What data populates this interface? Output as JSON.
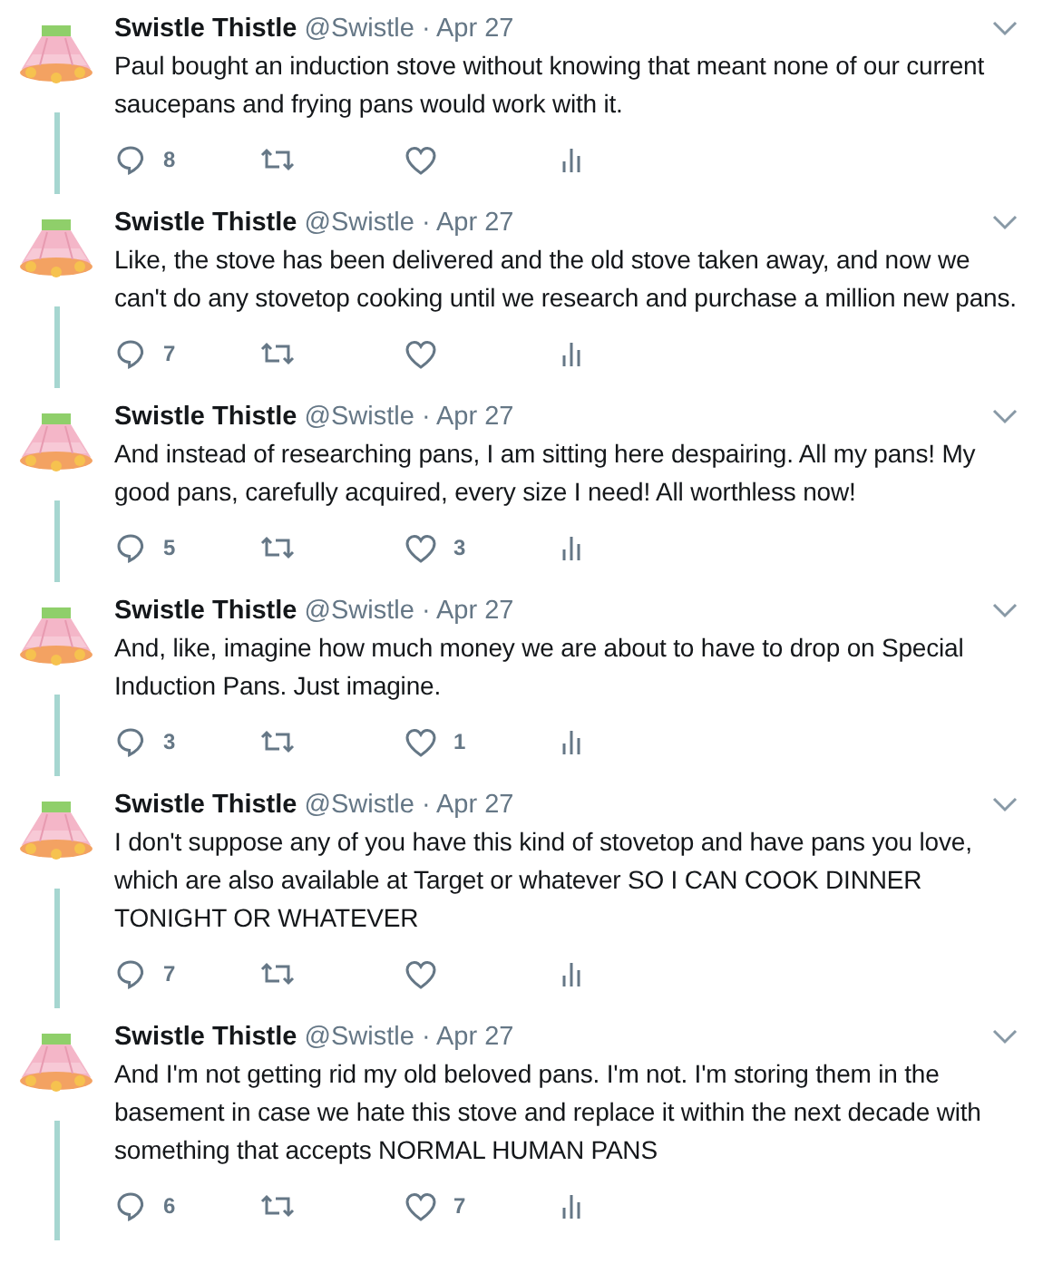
{
  "separator": "·",
  "tweets": [
    {
      "name": "Swistle Thistle",
      "handle": "@Swistle",
      "date": "Apr 27",
      "text": "Paul bought an induction stove without knowing that meant none of our current saucepans and frying pans would work with it.",
      "replies": "8"
    },
    {
      "name": "Swistle Thistle",
      "handle": "@Swistle",
      "date": "Apr 27",
      "text": "Like, the stove has been delivered and the old stove taken away, and now we can't do any stovetop cooking until we research and purchase a million new pans.",
      "replies": "7"
    },
    {
      "name": "Swistle Thistle",
      "handle": "@Swistle",
      "date": "Apr 27",
      "text": "And instead of researching pans, I am sitting here despairing. All my pans! My good pans, carefully acquired, every size I need! All worthless now!",
      "replies": "5",
      "likes": "3"
    },
    {
      "name": "Swistle Thistle",
      "handle": "@Swistle",
      "date": "Apr 27",
      "text": "And, like, imagine how much money we are about to have to drop on Special Induction Pans. Just imagine.",
      "replies": "3",
      "likes": "1"
    },
    {
      "name": "Swistle Thistle",
      "handle": "@Swistle",
      "date": "Apr 27",
      "text": "I don't suppose any of you have this kind of stovetop and have pans you love, which are also available at Target or whatever SO I CAN COOK DINNER TONIGHT OR WHATEVER",
      "replies": "7"
    },
    {
      "name": "Swistle Thistle",
      "handle": "@Swistle",
      "date": "Apr 27",
      "text": "And I'm not getting rid my old beloved pans. I'm not. I'm storing them in the basement in case we hate this stove and replace it within the next decade with something that accepts NORMAL HUMAN PANS",
      "replies": "6",
      "likes": "7"
    }
  ]
}
